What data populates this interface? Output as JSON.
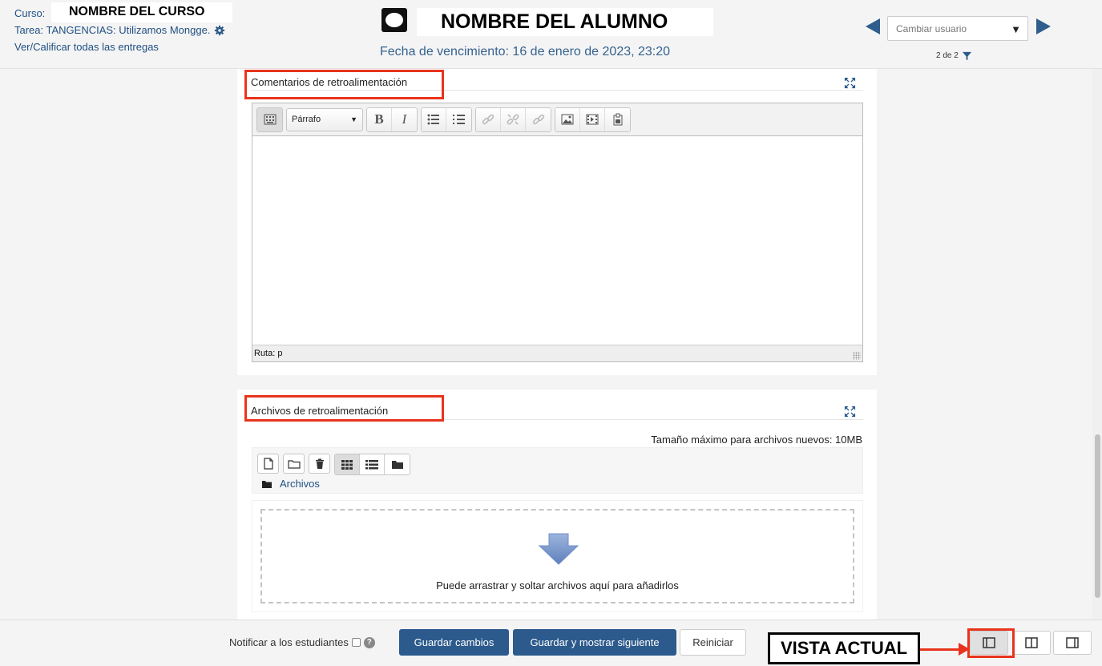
{
  "header": {
    "course_label": "Curso:",
    "course_name": "NOMBRE DEL CURSO",
    "task": "Tarea: TANGENCIAS: Utilizamos Mongge.",
    "view_all": "Ver/Calificar todas las entregas",
    "student_name": "NOMBRE DEL ALUMNO",
    "due_date": "Fecha de vencimiento: 16 de enero de 2023, 23:20",
    "user_select_placeholder": "Cambiar usuario",
    "user_count": "2 de 2"
  },
  "feedback_comments": {
    "title": "Comentarios de retroalimentación",
    "paragraph_select": "Párrafo",
    "path": "Ruta: p"
  },
  "feedback_files": {
    "title": "Archivos de retroalimentación",
    "max_size": "Tamaño máximo para archivos nuevos: 10MB",
    "folder": "Archivos",
    "drop_text": "Puede arrastrar y soltar archivos aquí para añadirlos"
  },
  "footer": {
    "notify": "Notificar a los estudiantes",
    "help": "?",
    "save": "Guardar cambios",
    "save_next": "Guardar y mostrar siguiente",
    "reset": "Reiniciar",
    "vista_actual": "VISTA ACTUAL"
  },
  "colors": {
    "accent": "#2c5a8c",
    "link": "#1f4f82",
    "annotation_red": "#e8341c"
  }
}
